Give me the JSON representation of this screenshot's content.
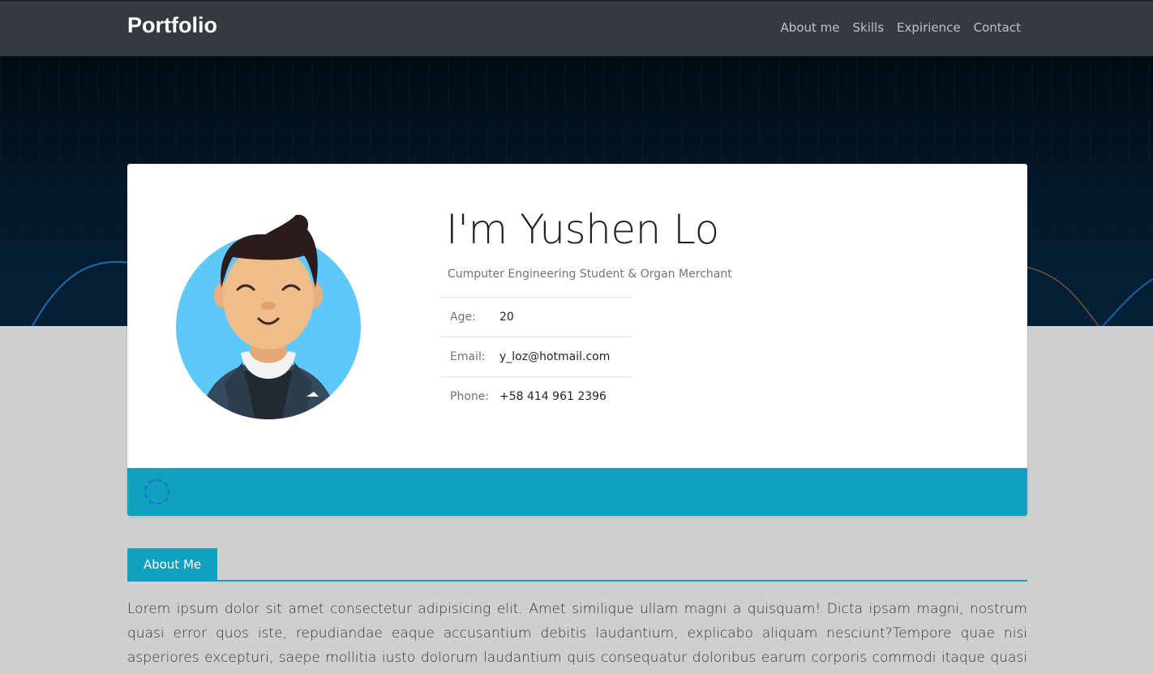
{
  "navbar": {
    "brand": "Portfolio",
    "links": [
      "About me",
      "Skills",
      "Expirience",
      "Contact"
    ]
  },
  "profile": {
    "name": "I'm Yushen Lo",
    "subtitle": "Cumputer Engineering Student & Organ Merchant",
    "info": [
      {
        "label": "Age:",
        "value": "20"
      },
      {
        "label": "Email:",
        "value": "y_loz@hotmail.com"
      },
      {
        "label": "Phone:",
        "value": "+58 414 961 2396"
      }
    ]
  },
  "about": {
    "tab_label": "About Me",
    "text": "Lorem ipsum dolor sit amet consectetur adipisicing elit. Amet similique ullam magni a quisquam! Dicta ipsam magni, nostrum quasi error quos iste, repudiandae eaque accusantium debitis laudantium, explicabo aliquam nesciunt?Tempore quae nisi asperiores excepturi, saepe mollitia iusto dolorum laudantium quis consequatur doloribus earum corporis commodi itaque quasi maxime soluta"
  },
  "colors": {
    "navbar": "#343a40",
    "accent": "#11a0bd",
    "page_bg": "#cfcfcf"
  },
  "icons": {
    "avatar": "avatar-illustration",
    "footer": "loading-circle-icon"
  }
}
